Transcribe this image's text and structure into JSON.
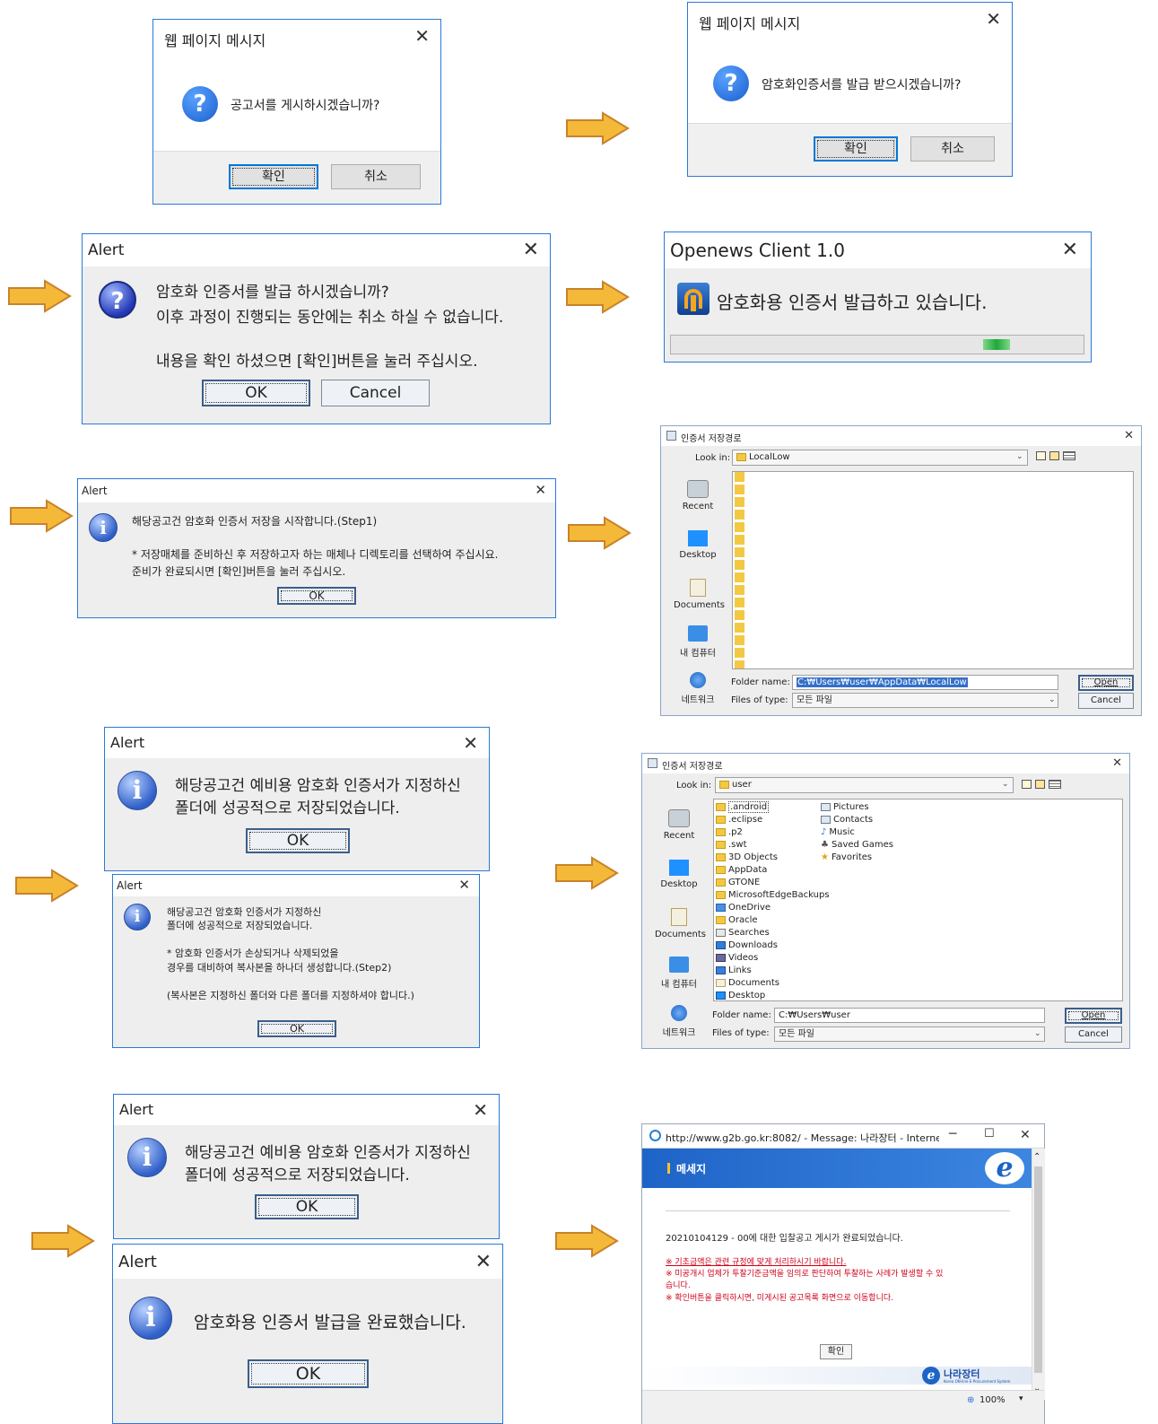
{
  "colors": {
    "accent": "#2b79d6",
    "arrow_fill": "#f5b93a",
    "arrow_edge": "#c9822a",
    "ie_header": "#1e64c8",
    "notice_red": "#d0021b"
  },
  "dlg1": {
    "title": "웹 페이지 메시지",
    "message": "공고서를 게시하시겠습니까?",
    "ok": "확인",
    "cancel": "취소"
  },
  "dlg2": {
    "title": "웹 페이지 메시지",
    "message": "암호화인증서를 발급 받으시겠습니까?",
    "ok": "확인",
    "cancel": "취소"
  },
  "dlg3": {
    "title": "Alert",
    "line1": "암호화 인증서를 발급 하시겠습니까?",
    "line2": "이후 과정이 진행되는 동안에는 취소 하실 수 없습니다.",
    "line3": "내용을 확인 하셨으면 [확인]버튼을 눌러 주십시오.",
    "ok": "OK",
    "cancel": "Cancel"
  },
  "dlg4": {
    "title": "Openews Client 1.0",
    "message": "암호화용 인증서 발급하고 있습니다."
  },
  "dlg5": {
    "title": "Alert",
    "line1": "해당공고건 암호화 인증서 저장을 시작합니다.(Step1)",
    "line2": "* 저장매체를 준비하신 후 저장하고자 하는 매체나 디렉토리를 선택하여 주십시요.",
    "line3": "준비가 완료되시면 [확인]버튼을 눌러 주십시오.",
    "ok": "OK"
  },
  "chooser1": {
    "title": "인증서 저장경로",
    "look_in_label": "Look in:",
    "look_in_value": "LocalLow",
    "sidebar": [
      "Recent",
      "Desktop",
      "Documents",
      "내 컴퓨터",
      "네트워크"
    ],
    "folder_name_label": "Folder name:",
    "folder_name_value": "C:₩Users₩user₩AppData₩LocalLow",
    "files_of_type_label": "Files of type:",
    "files_of_type_value": "모든 파일",
    "open": "Open",
    "cancel": "Cancel"
  },
  "dlg6": {
    "title": "Alert",
    "line1": "해당공고건 예비용 암호화 인증서가 지정하신",
    "line2": "폴더에 성공적으로 저장되었습니다.",
    "ok": "OK"
  },
  "dlg7": {
    "title": "Alert",
    "line1": "해당공고건 암호화 인증서가 지정하신",
    "line2": "폴더에 성공적으로 저장되었습니다.",
    "line3": "* 암호화 인증서가 손상되거나 삭제되었을",
    "line4": "경우를 대비하여 복사본을 하나더 생성합니다.(Step2)",
    "line5": "(복사본은 지정하신 폴더와 다른 폴더를 지정하셔야 합니다.)",
    "ok": "OK"
  },
  "chooser2": {
    "title": "인증서 저장경로",
    "look_in_label": "Look in:",
    "look_in_value": "user",
    "sidebar": [
      "Recent",
      "Desktop",
      "Documents",
      "내 컴퓨터",
      "네트워크"
    ],
    "col1": [
      ".android",
      ".eclipse",
      ".p2",
      ".swt",
      "3D Objects",
      "AppData",
      "GTONE",
      "MicrosoftEdgeBackups",
      "OneDrive",
      "Oracle",
      "Searches",
      "Downloads",
      "Videos",
      "Links",
      "Documents",
      "Desktop"
    ],
    "col2": [
      "Pictures",
      "Contacts",
      "Music",
      "Saved Games",
      "Favorites"
    ],
    "folder_name_label": "Folder name:",
    "folder_name_value": "C:₩Users₩user",
    "files_of_type_label": "Files of type:",
    "files_of_type_value": "모든 파일",
    "open": "Open",
    "cancel": "Cancel"
  },
  "dlg8": {
    "title": "Alert",
    "line1": "해당공고건 예비용 암호화 인증서가 지정하신",
    "line2": "폴더에 성공적으로 저장되었습니다.",
    "ok": "OK"
  },
  "dlg9": {
    "title": "Alert",
    "message": "암호화용 인증서 발급을 완료했습니다.",
    "ok": "OK"
  },
  "ie": {
    "title": "http://www.g2b.go.kr:8082/ - Message: 나라장터 - Internet ...",
    "header": "메세지",
    "main": "20210104129 - 00에 대한 입찰공고 게시가 완료되었습니다.",
    "note1": "※ 기초금액은 관련 규정에 맞게 처리하시기 바랍니다.",
    "note2a": "※ 미공개시 업체가 투찰기준금액을 임의로 판단하여 투찰하는 사례가 발생할 수 있",
    "note2b": "습니다.",
    "note3": "※ 확인버튼을 클릭하시면, 미게시된 공고목록 화면으로 이동합니다.",
    "ok": "확인",
    "logo": "나라장터",
    "logo_sub": "Korea ON-line E-Procurement System",
    "zoom": "100%"
  }
}
